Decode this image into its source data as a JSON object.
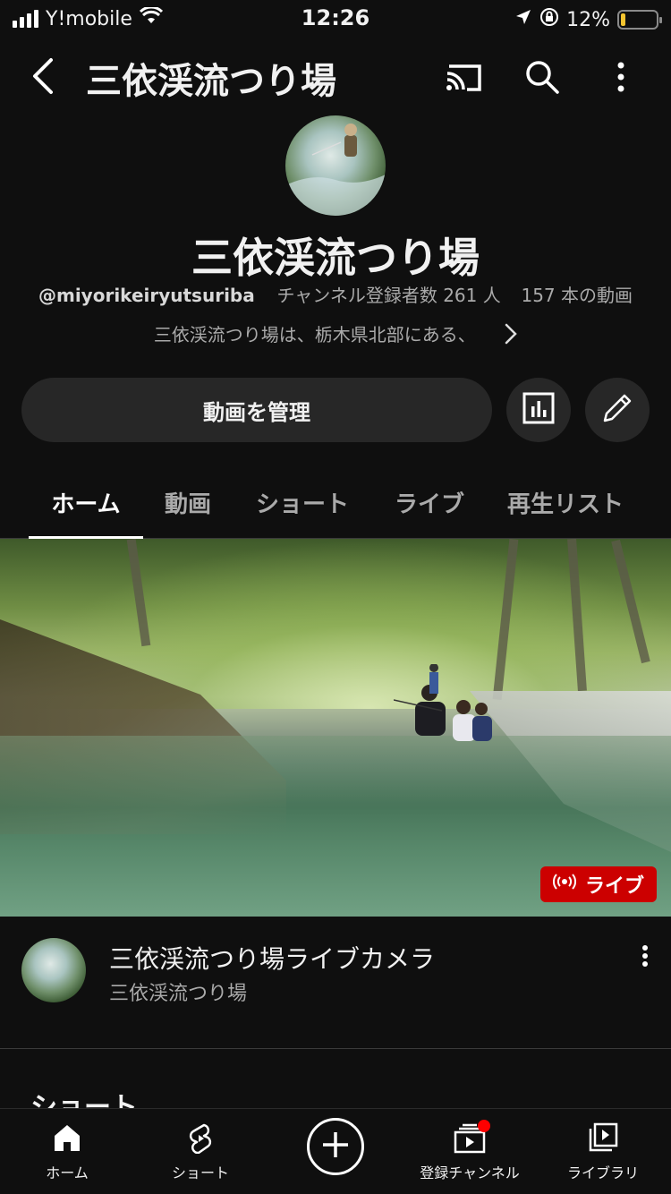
{
  "status_bar": {
    "carrier": "Y!mobile",
    "time": "12:26",
    "battery_text": "12%",
    "battery_level": 0.12,
    "battery_color": "#f4c430"
  },
  "app_bar": {
    "title": "三依渓流つり場",
    "icons": [
      "back-chevron-icon",
      "cast-icon",
      "search-icon",
      "more-vert-icon"
    ]
  },
  "channel": {
    "name": "三依渓流つり場",
    "handle": "@miyorikeiryutsuriba",
    "subscribers": "チャンネル登録者数 261 人",
    "video_count": "157 本の動画",
    "description": "三依渓流つり場は、栃木県北部にある、"
  },
  "actions": {
    "manage_label": "動画を管理",
    "icons": [
      "analytics-icon",
      "edit-pencil-icon"
    ]
  },
  "tabs": [
    {
      "label": "ホーム",
      "active": true
    },
    {
      "label": "動画",
      "active": false
    },
    {
      "label": "ショート",
      "active": false
    },
    {
      "label": "ライブ",
      "active": false
    },
    {
      "label": "再生リスト",
      "active": false
    }
  ],
  "featured_video": {
    "badge": "ライブ",
    "badge_color": "#cc0000",
    "title": "三依渓流つり場ライブカメラ",
    "channel": "三依渓流つり場"
  },
  "shorts_section": {
    "title": "ショート"
  },
  "bottom_nav": [
    {
      "label": "ホーム",
      "icon": "home-icon"
    },
    {
      "label": "ショート",
      "icon": "shorts-icon"
    },
    {
      "label": "",
      "icon": "create-plus-icon"
    },
    {
      "label": "登録チャンネル",
      "icon": "subscriptions-icon"
    },
    {
      "label": "ライブラリ",
      "icon": "library-icon"
    }
  ]
}
